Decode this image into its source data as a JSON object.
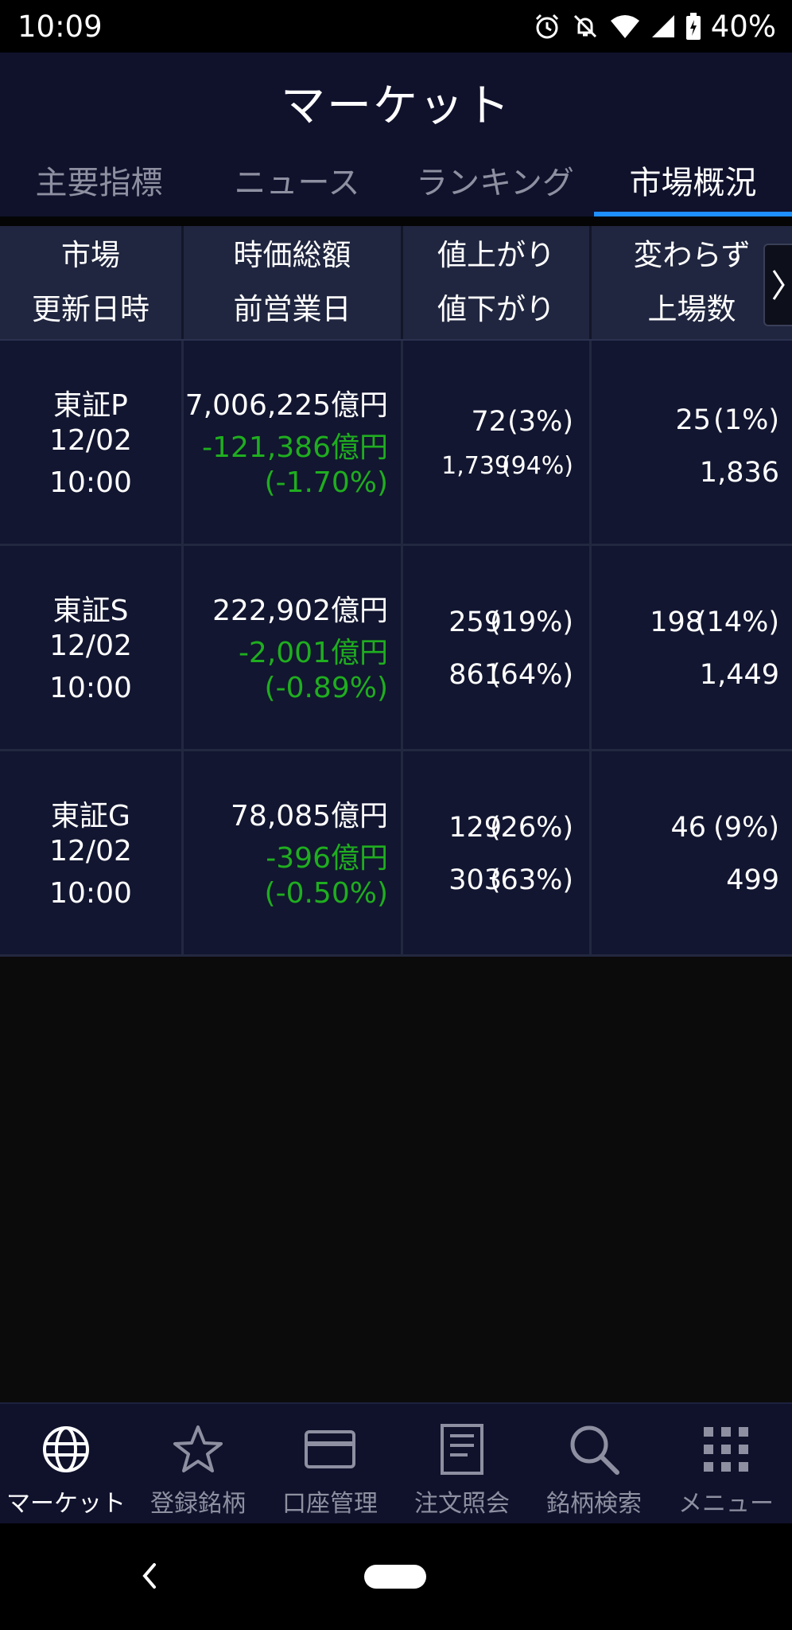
{
  "status_bar": {
    "time": "10:09",
    "battery": "40%"
  },
  "header": {
    "title": "マーケット",
    "tabs": [
      {
        "label": "主要指標",
        "active": false
      },
      {
        "label": "ニュース",
        "active": false
      },
      {
        "label": "ランキング",
        "active": false
      },
      {
        "label": "市場概況",
        "active": true
      }
    ]
  },
  "table": {
    "headers": {
      "col1": [
        "市場",
        "更新日時"
      ],
      "col2": [
        "時価総額",
        "前営業日"
      ],
      "col3": [
        "値上がり",
        "値下がり"
      ],
      "col4": [
        "変わらず",
        "上場数"
      ]
    },
    "rows": [
      {
        "market": "東証P",
        "date": "12/02",
        "time": "10:00",
        "market_cap": "7,006,225億円",
        "change": "-121,386億円",
        "change_pct": "(-1.70%)",
        "advances": "72",
        "advances_pct": "(3%)",
        "declines": "1,739",
        "declines_pct": "(94%)",
        "unchanged": "25",
        "unchanged_pct": "(1%)",
        "listed": "1,836"
      },
      {
        "market": "東証S",
        "date": "12/02",
        "time": "10:00",
        "market_cap": "222,902億円",
        "change": "-2,001億円",
        "change_pct": "(-0.89%)",
        "advances": "259",
        "advances_pct": "(19%)",
        "declines": "861",
        "declines_pct": "(64%)",
        "unchanged": "198",
        "unchanged_pct": "(14%)",
        "listed": "1,449"
      },
      {
        "market": "東証G",
        "date": "12/02",
        "time": "10:00",
        "market_cap": "78,085億円",
        "change": "-396億円",
        "change_pct": "(-0.50%)",
        "advances": "129",
        "advances_pct": "(26%)",
        "declines": "303",
        "declines_pct": "(63%)",
        "unchanged": "46",
        "unchanged_pct": "(9%)",
        "listed": "499"
      }
    ]
  },
  "bottom_nav": [
    {
      "label": "マーケット",
      "icon": "globe-icon",
      "active": true
    },
    {
      "label": "登録銘柄",
      "icon": "star-icon",
      "active": false
    },
    {
      "label": "口座管理",
      "icon": "card-icon",
      "active": false
    },
    {
      "label": "注文照会",
      "icon": "document-icon",
      "active": false
    },
    {
      "label": "銘柄検索",
      "icon": "search-icon",
      "active": false
    },
    {
      "label": "メニュー",
      "icon": "grid-icon",
      "active": false
    }
  ],
  "colors": {
    "header_bg": "#10122c",
    "row_bg": "#121630",
    "negative": "#1fae1f",
    "tab_indicator": "#1e90ff",
    "inactive_text": "#8e90a1"
  }
}
